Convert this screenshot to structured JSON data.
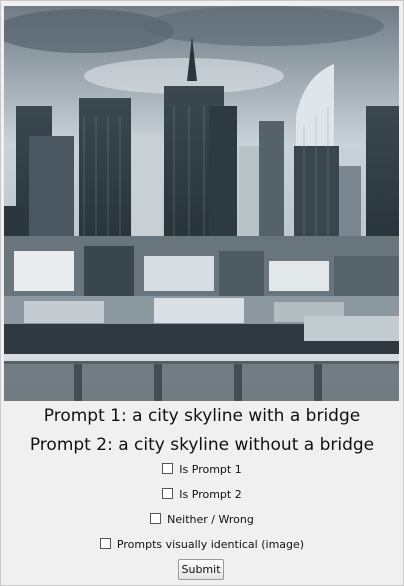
{
  "image": {
    "alt_icon": "city-skyline-with-bridge-photo"
  },
  "prompts": {
    "prompt1": "Prompt 1: a city skyline with a bridge",
    "prompt2": "Prompt 2: a city skyline without a bridge"
  },
  "options": [
    {
      "label": "Is Prompt 1",
      "checked": false
    },
    {
      "label": "Is Prompt 2",
      "checked": false
    },
    {
      "label": "Neither / Wrong",
      "checked": false
    },
    {
      "label": "Prompts visually identical (image)",
      "checked": false
    }
  ],
  "submit": {
    "label": "Submit"
  },
  "colors": {
    "background": "#f0f0f0",
    "photo_tint": "#8c9aa3"
  }
}
